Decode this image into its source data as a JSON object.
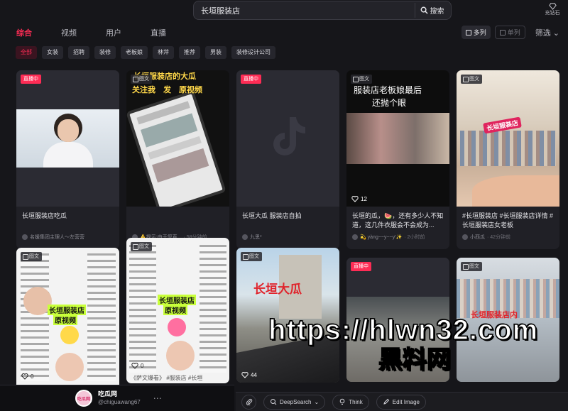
{
  "search": {
    "value": "长垣服装店",
    "button_label": "搜索"
  },
  "top_right": {
    "charge_label": "充钻石"
  },
  "main_tabs": [
    {
      "label": "综合",
      "active": true
    },
    {
      "label": "视频",
      "active": false
    },
    {
      "label": "用户",
      "active": false
    },
    {
      "label": "直播",
      "active": false
    }
  ],
  "view": {
    "double_label": "多列",
    "single_label": "单列",
    "filter_label": "筛选"
  },
  "chips": [
    {
      "label": "全部",
      "active": true
    },
    {
      "label": "女装"
    },
    {
      "label": "招聘"
    },
    {
      "label": "装修"
    },
    {
      "label": "老板娘"
    },
    {
      "label": "林萍"
    },
    {
      "label": "推荐"
    },
    {
      "label": "男装"
    },
    {
      "label": "装修设计公司"
    }
  ],
  "cards": [
    {
      "badge": "直播中",
      "title": "长垣服装店吃瓜",
      "author": "名媛集团主理人～左营营",
      "time": ""
    },
    {
      "badge": "图文",
      "overlay1": "长垣服装店的大瓜",
      "overlay2": "关注我　发　原视频",
      "title": "",
      "author": "⚠️提示:由于您直...",
      "time": "· 58分钟前"
    },
    {
      "badge": "直播中",
      "title": "长垣大瓜 服装店自拍",
      "author": "九思*",
      "time": ""
    },
    {
      "badge": "图文",
      "overlay1": "服装店老板娘最后",
      "overlay2": "还抛个眼",
      "likes": "12",
      "title": "长垣的瓜，🍉，还有多少人不知道，这几件衣服会不会成为...",
      "author": "💫 yàng~~y~~y'✨",
      "time": "· 2小时前"
    },
    {
      "badge": "图文",
      "overlay1": "长垣服装店",
      "title": "#长垣服装店 #长垣服装店详情 #长垣服装店女老板",
      "author": "小西瓜",
      "time": "· 42分钟前"
    },
    {
      "badge": "图文",
      "overlay1": "长垣服装店",
      "overlay2": "原视频",
      "likes": "0"
    },
    {
      "badge": "图文",
      "overlay1": "长垣服装店",
      "overlay2": "原视频",
      "likes": "0",
      "title": "《萨文爆看》 #服装店 #长垣"
    },
    {
      "badge": "图文",
      "overlay1": "长垣大瓜",
      "likes": "44"
    },
    {
      "badge": "直播中"
    },
    {
      "badge": "图文",
      "overlay1": "长垣服装店内"
    }
  ],
  "bottom": {
    "logo_text": "吃瓜网",
    "account_name": "吃瓜网",
    "account_handle": "@chiguawang67",
    "tools": [
      "DeepSearch",
      "Think",
      "Edit Image"
    ]
  },
  "watermark": {
    "line1": "https://hlwn32.com",
    "line2": "黑料网"
  },
  "colors": {
    "accent": "#fe2c55",
    "background": "#16161a",
    "card": "#202026"
  }
}
